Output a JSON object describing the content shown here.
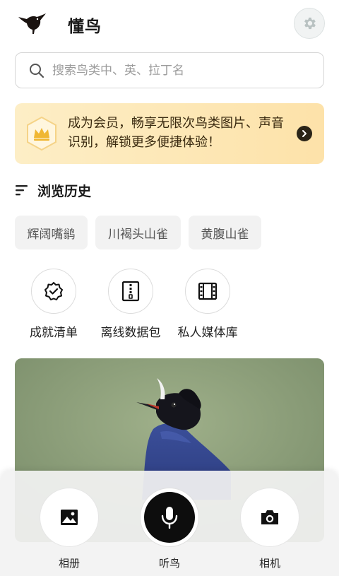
{
  "app": {
    "title": "懂鸟"
  },
  "search": {
    "placeholder": "搜索鸟类中、英、拉丁名",
    "value": ""
  },
  "vip": {
    "text": "成为会员，畅享无限次鸟类图片、声音识别，解锁更多便捷体验！"
  },
  "history": {
    "title": "浏览历史",
    "items": [
      "辉阔嘴鹟",
      "川褐头山雀",
      "黄腹山雀"
    ]
  },
  "quick_actions": [
    {
      "label": "成就清单",
      "icon": "badge-check-icon"
    },
    {
      "label": "离线数据包",
      "icon": "archive-zip-icon"
    },
    {
      "label": "私人媒体库",
      "icon": "film-icon"
    }
  ],
  "bottom_actions": [
    {
      "label": "相册",
      "icon": "image-icon"
    },
    {
      "label": "听鸟",
      "icon": "microphone-icon"
    },
    {
      "label": "相机",
      "icon": "camera-icon"
    }
  ],
  "colors": {
    "accent": "#0d0d0d",
    "banner": "#fde2a9"
  }
}
